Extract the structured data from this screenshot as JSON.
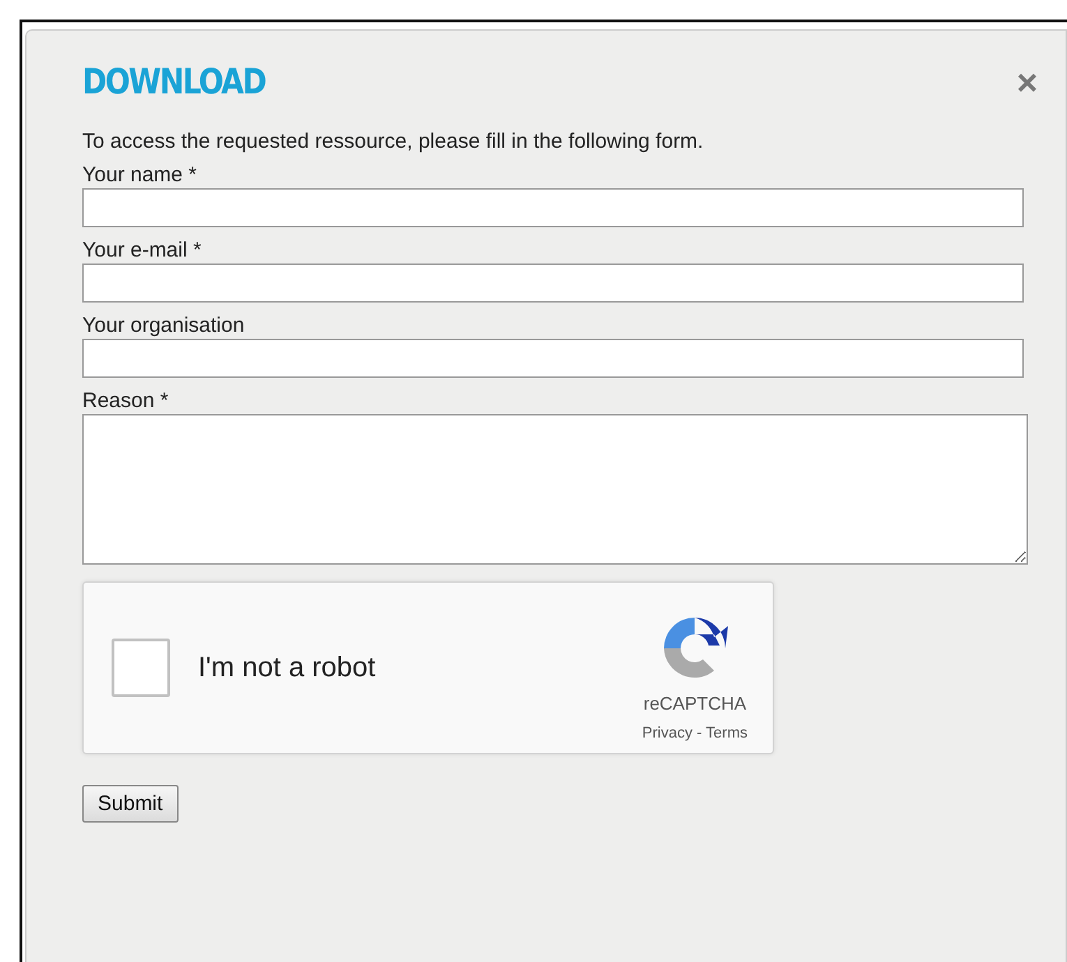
{
  "dialog": {
    "title": "DOWNLOAD",
    "close": "×"
  },
  "intro": "To access the requested ressource, please fill in the following form.",
  "fields": [
    {
      "kind": "input",
      "label": "Your name *"
    },
    {
      "kind": "input",
      "label": "Your e-mail *"
    },
    {
      "kind": "input",
      "label": "Your organisation"
    },
    {
      "kind": "textarea",
      "label": "Reason *"
    }
  ],
  "captcha": {
    "label": "I'm not a robot",
    "checked": false,
    "brand": "reCAPTCHA",
    "links": "Privacy - Terms"
  },
  "submit": "Submit"
}
